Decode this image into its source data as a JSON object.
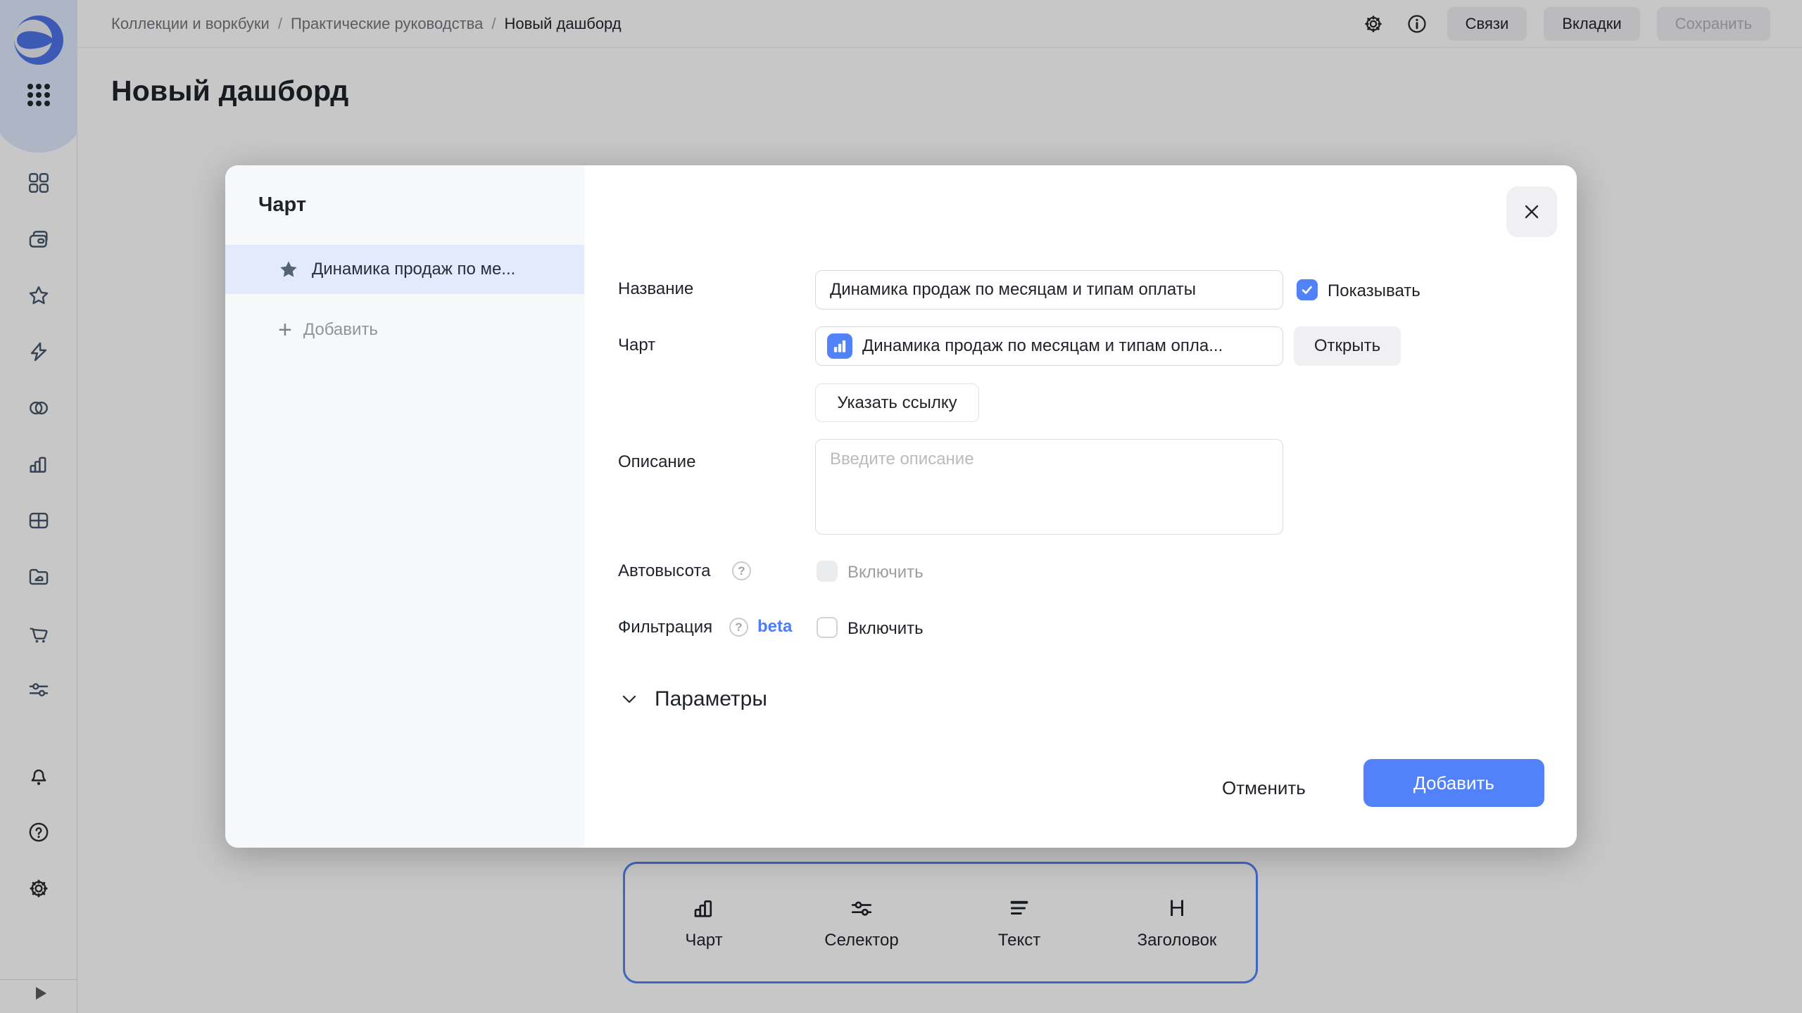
{
  "colors": {
    "accent": "#5282fa",
    "beta_blue": "#4a7dff",
    "selected_row_bg": "#e3eafc",
    "star_fill": "#55626f",
    "sidebar_top_bg": "#dfe8fc",
    "toolbar_border": "#5282fa"
  },
  "header": {
    "breadcrumbs": [
      "Коллекции и воркбуки",
      "Практические руководства",
      "Новый дашборд"
    ],
    "separator": "/",
    "icons": [
      "settings-gear-icon",
      "info-circle-icon"
    ],
    "buttons": {
      "links": "Связи",
      "tabs": "Вкладки",
      "save": "Сохранить"
    }
  },
  "page": {
    "title": "Новый дашборд"
  },
  "sidebar": {
    "icons": [
      "datalens-logo",
      "apps-dots-grid",
      "collections-grid",
      "workbooks-folders",
      "favorites-star",
      "editor-lightning",
      "relations-venn",
      "charts-bars",
      "tables-grid",
      "files-folder",
      "marketplace-cart",
      "services-sliders",
      "notifications-bell",
      "help-question",
      "settings-gear",
      "expand-play"
    ]
  },
  "toolbar": {
    "items": [
      {
        "icon": "chart-bars-icon",
        "label": "Чарт"
      },
      {
        "icon": "selector-sliders-icon",
        "label": "Селектор"
      },
      {
        "icon": "text-lines-icon",
        "label": "Текст"
      },
      {
        "icon": "heading-h-icon",
        "label": "Заголовок",
        "glyph": "H"
      }
    ]
  },
  "modal": {
    "panel": {
      "title": "Чарт",
      "selected_item": "Динамика продаж по ме...",
      "add_plus": "+",
      "add_label": "Добавить"
    },
    "form": {
      "name_label": "Название",
      "name_value": "Динамика продаж по месяцам и типам оплаты",
      "show_checkbox_label": "Показывать",
      "chart_label": "Чарт",
      "chart_value": "Динамика продаж по месяцам и типам опла...",
      "open_button": "Открыть",
      "link_button": "Указать ссылку",
      "description_label": "Описание",
      "description_placeholder": "Введите описание",
      "autoheight_label": "Автовысота",
      "autoheight_checkbox_label": "Включить",
      "filtration_label": "Фильтрация",
      "filtration_beta": "beta",
      "filtration_checkbox_label": "Включить",
      "help_glyph": "?",
      "params_section": "Параметры"
    },
    "footer": {
      "cancel": "Отменить",
      "submit": "Добавить"
    }
  }
}
